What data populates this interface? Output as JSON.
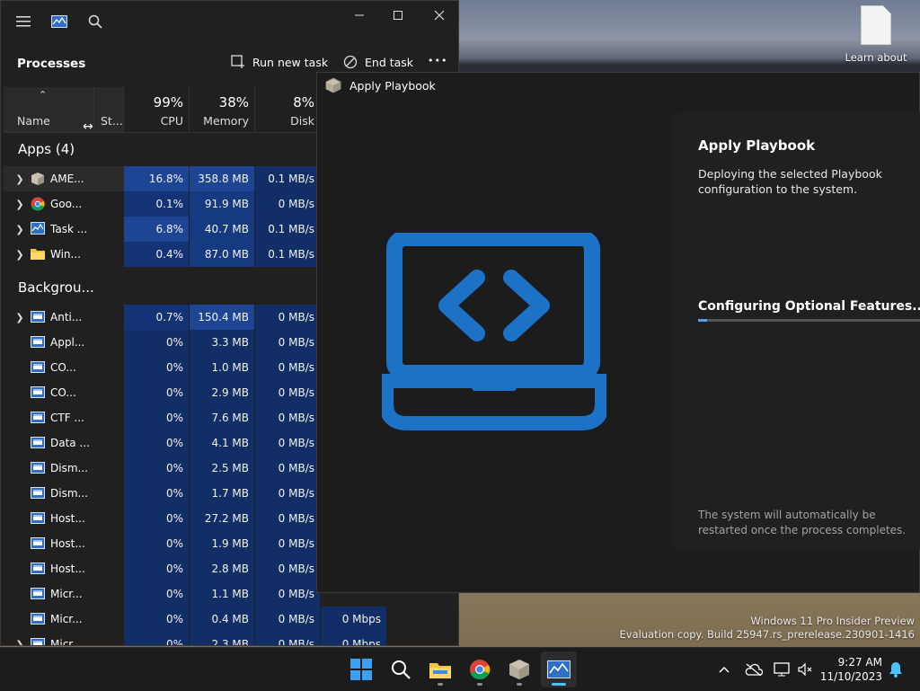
{
  "desktop": {
    "icon_label": "Learn about",
    "watermark_line1": "Windows 11 Pro Insider Preview",
    "watermark_line2": "Evaluation copy. Build 25947.rs_prerelease.230901-1416"
  },
  "task_manager": {
    "section_title": "Processes",
    "run_new_task": "Run new task",
    "end_task": "End task",
    "more": "•••",
    "columns": {
      "name": "Name",
      "status": "St...",
      "cpu_pct": "99%",
      "cpu": "CPU",
      "mem_pct": "38%",
      "mem": "Memory",
      "disk_pct": "8%",
      "disk": "Disk"
    },
    "apps_header": "Apps (4)",
    "background_header": "Backgrou...",
    "apps": [
      {
        "name": "AME...",
        "cpu": "16.8%",
        "mem": "358.8 MB",
        "disk": "0.1 MB/s",
        "icon": "ame-box-icon",
        "expand": true
      },
      {
        "name": "Goo...",
        "cpu": "0.1%",
        "mem": "91.9 MB",
        "disk": "0 MB/s",
        "icon": "chrome-icon",
        "expand": true
      },
      {
        "name": "Task ...",
        "cpu": "6.8%",
        "mem": "40.7 MB",
        "disk": "0.1 MB/s",
        "icon": "task-manager-icon",
        "expand": true
      },
      {
        "name": "Win...",
        "cpu": "0.4%",
        "mem": "87.0 MB",
        "disk": "0.1 MB/s",
        "icon": "file-explorer-icon",
        "expand": true
      }
    ],
    "background": [
      {
        "name": "Anti...",
        "cpu": "0.7%",
        "mem": "150.4 MB",
        "disk": "0 MB/s",
        "net": "",
        "expand": true
      },
      {
        "name": "Appl...",
        "cpu": "0%",
        "mem": "3.3 MB",
        "disk": "0 MB/s",
        "net": "",
        "expand": false
      },
      {
        "name": "CO...",
        "cpu": "0%",
        "mem": "1.0 MB",
        "disk": "0 MB/s",
        "net": "",
        "expand": false
      },
      {
        "name": "CO...",
        "cpu": "0%",
        "mem": "2.9 MB",
        "disk": "0 MB/s",
        "net": "",
        "expand": false
      },
      {
        "name": "CTF ...",
        "cpu": "0%",
        "mem": "7.6 MB",
        "disk": "0 MB/s",
        "net": "",
        "expand": false
      },
      {
        "name": "Data ...",
        "cpu": "0%",
        "mem": "4.1 MB",
        "disk": "0 MB/s",
        "net": "",
        "expand": false
      },
      {
        "name": "Dism...",
        "cpu": "0%",
        "mem": "2.5 MB",
        "disk": "0 MB/s",
        "net": "",
        "expand": false
      },
      {
        "name": "Dism...",
        "cpu": "0%",
        "mem": "1.7 MB",
        "disk": "0 MB/s",
        "net": "",
        "expand": false
      },
      {
        "name": "Host...",
        "cpu": "0%",
        "mem": "27.2 MB",
        "disk": "0 MB/s",
        "net": "",
        "expand": false
      },
      {
        "name": "Host...",
        "cpu": "0%",
        "mem": "1.9 MB",
        "disk": "0 MB/s",
        "net": "",
        "expand": false
      },
      {
        "name": "Host...",
        "cpu": "0%",
        "mem": "2.8 MB",
        "disk": "0 MB/s",
        "net": "",
        "expand": false
      },
      {
        "name": "Micr...",
        "cpu": "0%",
        "mem": "1.1 MB",
        "disk": "0 MB/s",
        "net": "",
        "expand": false
      },
      {
        "name": "Micr...",
        "cpu": "0%",
        "mem": "0.4 MB",
        "disk": "0 MB/s",
        "net": "0 Mbps",
        "expand": false
      },
      {
        "name": "Micr...",
        "cpu": "0%",
        "mem": "2.3 MB",
        "disk": "0 MB/s",
        "net": "0 Mbps",
        "expand": true
      }
    ]
  },
  "playbook": {
    "window_title": "Apply Playbook",
    "heading": "Apply Playbook",
    "description": "Deploying the selected Playbook configuration to the system.",
    "status": "Configuring Optional Features...",
    "progress": 0.04,
    "note": "The system will automatically be restarted once the process completes."
  },
  "taskbar": {
    "time": "9:27 AM",
    "date": "11/10/2023"
  },
  "colors": {
    "accent": "#4cc2ff",
    "heat_high": "#1f4a9a",
    "heat_low": "#123066",
    "laptop_blue": "#1b72c7"
  }
}
